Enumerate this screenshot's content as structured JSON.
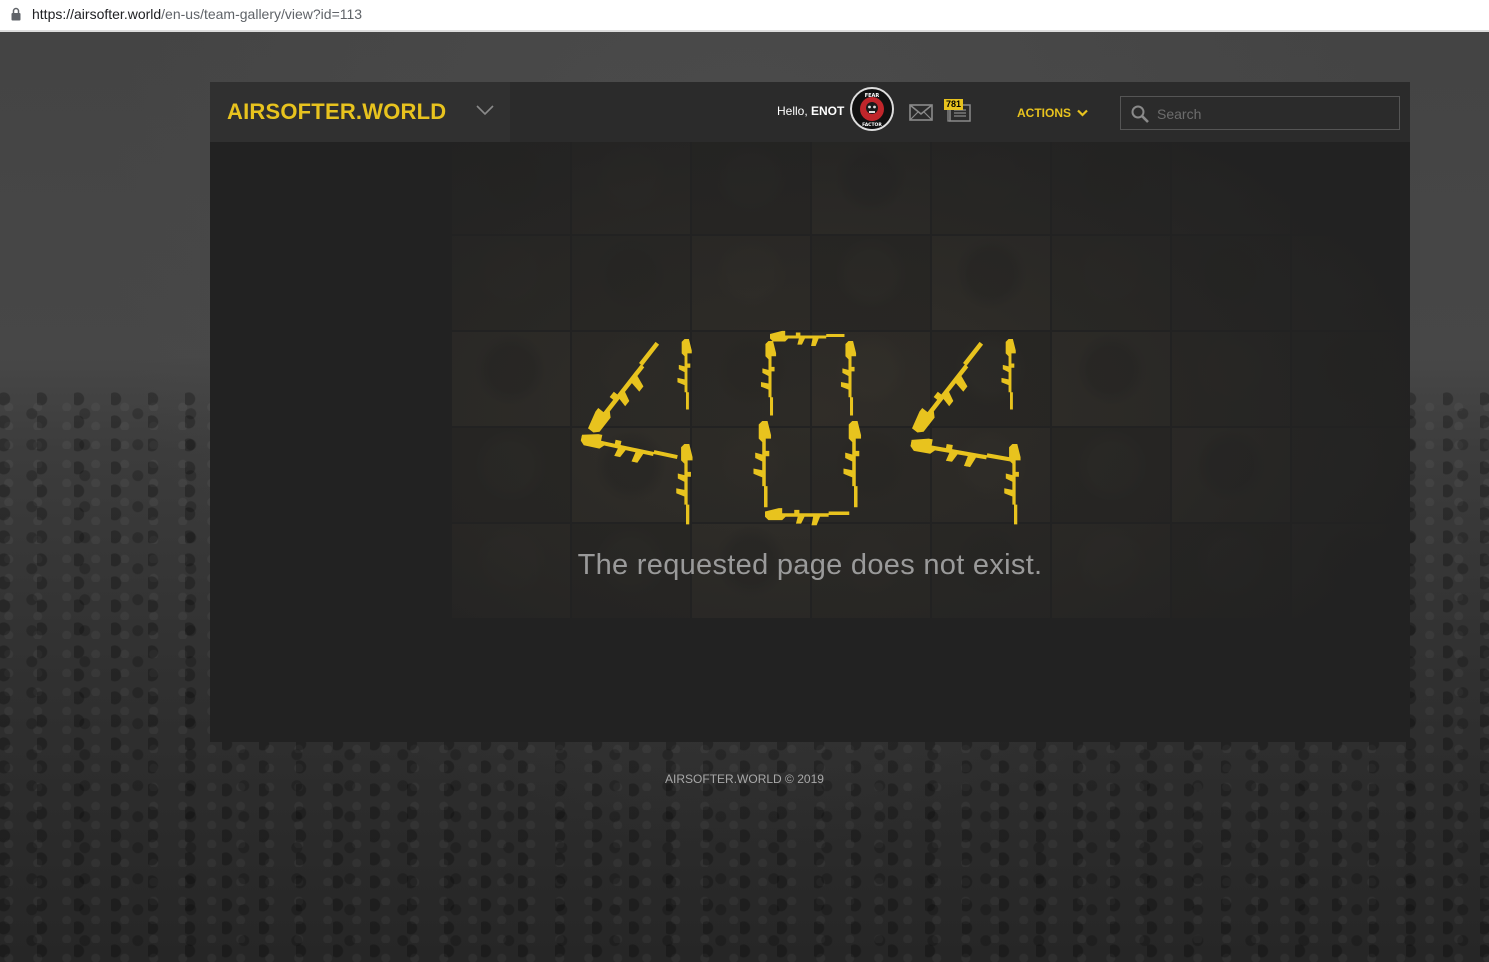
{
  "browser": {
    "url_host": "https://airsofter.world",
    "url_path": "/en-us/team-gallery/view?id=113"
  },
  "header": {
    "brand": "AIRSOFTER.WORLD",
    "greeting_prefix": "Hello, ",
    "username": "ENOT",
    "avatar_text_top": "FEAR",
    "avatar_text_bottom": "FACTOR",
    "news_badge": "781",
    "actions_label": "ACTIONS",
    "search_placeholder": "Search"
  },
  "error": {
    "code_digits": [
      "4",
      "0",
      "4"
    ],
    "message": "The requested page does not exist."
  },
  "footer": {
    "copyright": "AIRSOFTER.WORLD © 2019"
  },
  "colors": {
    "accent": "#e8c31e",
    "container_bg": "#222222",
    "navbar_bg": "#2b2b2b"
  },
  "icons": [
    "lock-icon",
    "chevron-down-icon",
    "mail-icon",
    "news-icon",
    "search-icon",
    "rifle-icon"
  ]
}
